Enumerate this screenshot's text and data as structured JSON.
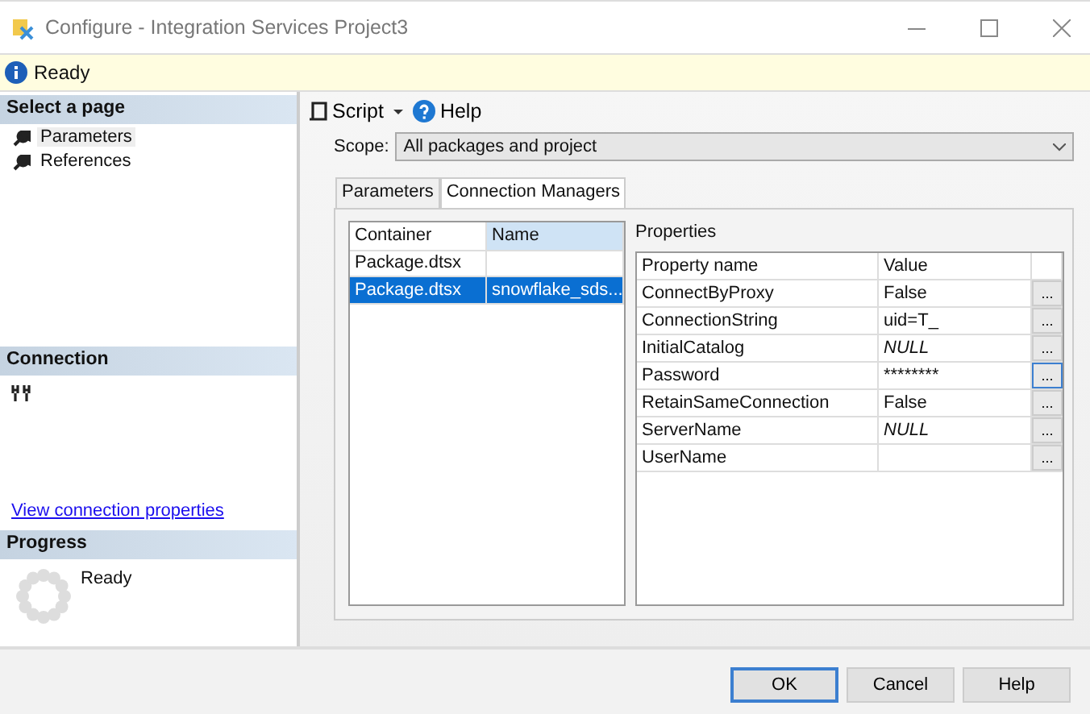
{
  "window": {
    "title": "Configure - Integration Services Project3"
  },
  "info_bar": {
    "text": "Ready"
  },
  "sidebar": {
    "header": "Select a page",
    "items": [
      {
        "label": "Parameters",
        "selected": true
      },
      {
        "label": "References",
        "selected": false
      }
    ],
    "connection": {
      "header": "Connection",
      "link": "View connection properties"
    },
    "progress": {
      "header": "Progress",
      "status": "Ready"
    }
  },
  "toolbar": {
    "script": "Script",
    "help": "Help"
  },
  "scope": {
    "label": "Scope:",
    "value": "All packages and project"
  },
  "tabs": [
    {
      "label": "Parameters",
      "selected": false
    },
    {
      "label": "Connection Managers",
      "selected": true
    }
  ],
  "connection_managers": {
    "columns": [
      "Container",
      "Name"
    ],
    "rows": [
      {
        "container": "Package.dtsx",
        "selected": false
      },
      {
        "container": "Package.dtsx",
        "name": "snowflake_sds...",
        "selected": true
      }
    ]
  },
  "properties": {
    "title": "Properties",
    "columns": [
      "Property name",
      "Value"
    ],
    "rows": [
      {
        "name": "ConnectByProxy",
        "value": "False",
        "kind": "text",
        "focused": false
      },
      {
        "name": "ConnectionString",
        "value": "uid=T_",
        "kind": "text",
        "focused": false
      },
      {
        "name": "InitialCatalog",
        "value": "NULL",
        "kind": "null",
        "focused": false
      },
      {
        "name": "Password",
        "value": "********",
        "kind": "text",
        "focused": true
      },
      {
        "name": "RetainSameConnection",
        "value": "False",
        "kind": "text",
        "focused": false
      },
      {
        "name": "ServerName",
        "value": "NULL",
        "kind": "null",
        "focused": false
      },
      {
        "name": "UserName",
        "kind": "text",
        "focused": false
      }
    ],
    "button_label": "..."
  },
  "buttons": [
    {
      "label": "OK",
      "default": true
    },
    {
      "label": "Cancel",
      "default": false
    },
    {
      "label": "Help",
      "default": false
    }
  ]
}
